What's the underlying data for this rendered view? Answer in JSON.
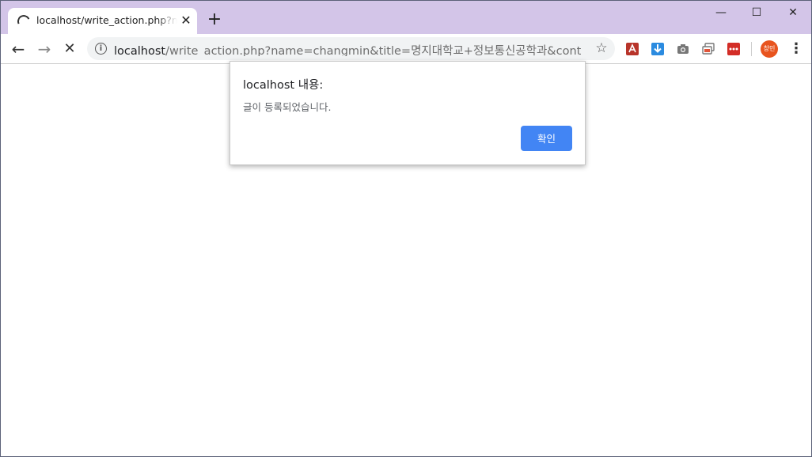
{
  "tab": {
    "title": "localhost/write_action.php?name=changmin"
  },
  "window_controls": {
    "minimize": "—",
    "maximize": "☐",
    "close": "✕"
  },
  "address_bar": {
    "host": "localhost",
    "path": "/write_action.php?name=changmin&title=명지대학교+정보통신공학과&content=..."
  },
  "profile": {
    "avatar_text": "창민"
  },
  "dialog": {
    "title": "localhost 내용:",
    "message": "글이 등록되었습니다.",
    "ok_label": "확인"
  },
  "colors": {
    "titlebar": "#d3c5e8",
    "ok_button": "#4285f4",
    "avatar": "#e8541e"
  }
}
